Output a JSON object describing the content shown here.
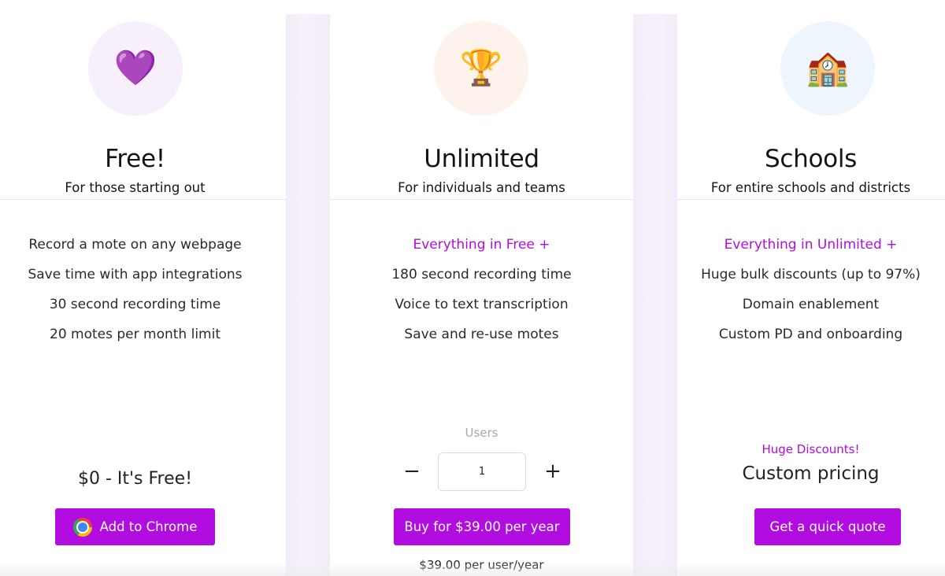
{
  "plans": [
    {
      "icon": "💜",
      "icon_name": "purple-heart-icon",
      "title": "Free!",
      "subtitle": "For those starting out",
      "features": [
        "Record a mote on any webpage",
        "Save time with app integrations",
        "30 second recording time",
        "20 motes per month limit"
      ],
      "price": "$0 - It's Free!",
      "cta_label": "Add to Chrome",
      "cta_icon": "chrome-icon"
    },
    {
      "icon": "🏆",
      "icon_name": "trophy-icon",
      "title": "Unlimited",
      "subtitle": "For individuals and teams",
      "features_header": "Everything in Free +",
      "features": [
        "180 second recording time",
        "Voice to text transcription",
        "Save and re-use motes"
      ],
      "users_label": "Users",
      "users_value": "1",
      "minus_label": "−",
      "plus_label": "+",
      "cta_label": "Buy for $39.00 per year",
      "per_user_price": "$39.00 per user/year"
    },
    {
      "icon": "🏫",
      "icon_name": "school-building-icon",
      "title": "Schools",
      "subtitle": "For entire schools and districts",
      "features_header": "Everything in Unlimited +",
      "features": [
        "Huge bulk discounts (up to 97%)",
        "Domain enablement",
        "Custom PD and onboarding"
      ],
      "discount_tag": "Huge Discounts!",
      "price": "Custom pricing",
      "cta_label": "Get a quick quote"
    }
  ],
  "colors": {
    "accent": "#b10de0",
    "gutter": "#f5eefa",
    "free_icon_bg": "#f7effc",
    "unlimited_icon_bg": "#fdf3ec",
    "schools_icon_bg": "#eff5fd"
  }
}
